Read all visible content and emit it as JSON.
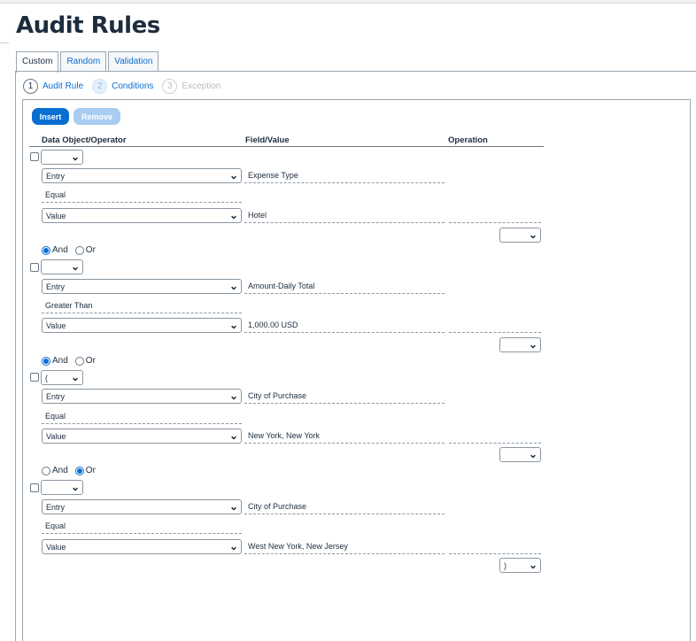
{
  "page": {
    "title": "Audit Rules"
  },
  "tabs": [
    {
      "label": "Custom",
      "active": true
    },
    {
      "label": "Random",
      "active": false
    },
    {
      "label": "Validation",
      "active": false
    }
  ],
  "steps": [
    {
      "num": "1",
      "label": "Audit Rule"
    },
    {
      "num": "2",
      "label": "Conditions"
    },
    {
      "num": "3",
      "label": "Exception"
    }
  ],
  "toolbar": {
    "insert_label": "Insert",
    "remove_label": "Remove"
  },
  "columns": {
    "data_object": "Data Object/Operator",
    "field_value": "Field/Value",
    "operation": "Operation"
  },
  "conditions": [
    {
      "paren_open": "",
      "object": "Entry",
      "field": "Expense Type",
      "operator": "Equal",
      "value_type": "Value",
      "value": "Hotel",
      "operation": "",
      "paren_close": "",
      "connector_after": "And"
    },
    {
      "paren_open": "",
      "object": "Entry",
      "field": "Amount-Daily Total",
      "operator": "Greater Than",
      "value_type": "Value",
      "value": "1,000.00 USD",
      "operation": "",
      "paren_close": "",
      "connector_after": "And"
    },
    {
      "paren_open": "(",
      "object": "Entry",
      "field": "City of Purchase",
      "operator": "Equal",
      "value_type": "Value",
      "value": "New York, New York",
      "operation": "",
      "paren_close": "",
      "connector_after": "Or"
    },
    {
      "paren_open": "",
      "object": "Entry",
      "field": "City of Purchase",
      "operator": "Equal",
      "value_type": "Value",
      "value": "West New York, New Jersey",
      "operation": "",
      "paren_close": ")"
    }
  ],
  "connector_labels": {
    "and": "And",
    "or": "Or"
  },
  "colors": {
    "accent": "#0a6ed1",
    "remove_disabled": "#a9cdf1",
    "title": "#1d2d3e"
  }
}
